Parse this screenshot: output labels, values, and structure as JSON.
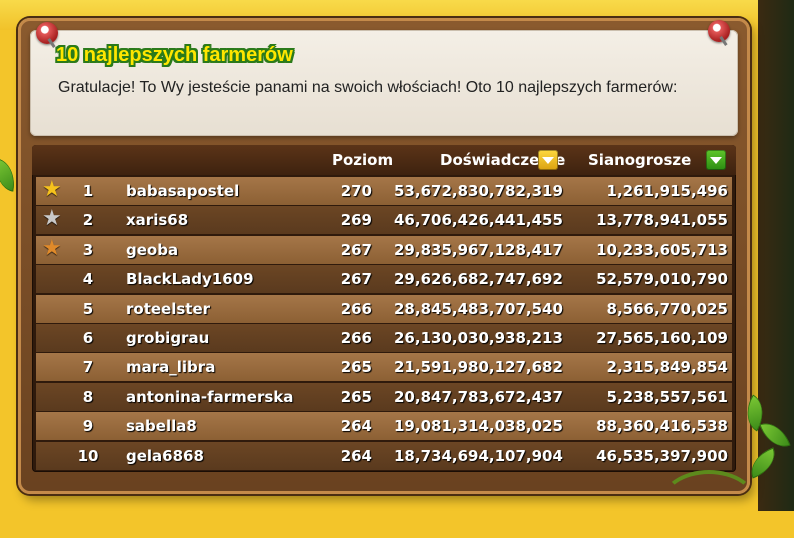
{
  "panel": {
    "title": "10 najlepszych farmerów",
    "subtitle": "Gratulacje! To Wy jesteście panami na swoich włościach! Oto 10 najlepszych farmerów:"
  },
  "table": {
    "headers": {
      "level": "Poziom",
      "experience": "Doświadczenie",
      "coins": "Sianogrosze"
    },
    "sort_buttons": [
      {
        "column": "experience",
        "icon": "chevron-down-icon",
        "color": "#f2b81c"
      },
      {
        "column": "coins",
        "icon": "chevron-down-icon",
        "color": "#3ea81d"
      }
    ],
    "rows": [
      {
        "rank": "1",
        "name": "babasapostel",
        "level": "270",
        "xp": "53,672,830,782,319",
        "coins": "1,261,915,496",
        "medal": "gold-star-icon",
        "medal_color": "#f6c21c"
      },
      {
        "rank": "2",
        "name": "xaris68",
        "level": "269",
        "xp": "46,706,426,441,455",
        "coins": "13,778,941,055",
        "medal": "silver-star-icon",
        "medal_color": "#c9c9c9"
      },
      {
        "rank": "3",
        "name": "geoba",
        "level": "267",
        "xp": "29,835,967,128,417",
        "coins": "10,233,605,713",
        "medal": "bronze-star-icon",
        "medal_color": "#e08a2a"
      },
      {
        "rank": "4",
        "name": "BlackLady1609",
        "level": "267",
        "xp": "29,626,682,747,692",
        "coins": "52,579,010,790"
      },
      {
        "rank": "5",
        "name": "roteelster",
        "level": "266",
        "xp": "28,845,483,707,540",
        "coins": "8,566,770,025"
      },
      {
        "rank": "6",
        "name": "grobigrau",
        "level": "266",
        "xp": "26,130,030,938,213",
        "coins": "27,565,160,109"
      },
      {
        "rank": "7",
        "name": "mara_libra",
        "level": "265",
        "xp": "21,591,980,127,682",
        "coins": "2,315,849,854"
      },
      {
        "rank": "8",
        "name": "antonina-farmerska",
        "level": "265",
        "xp": "20,847,783,672,437",
        "coins": "5,238,557,561"
      },
      {
        "rank": "9",
        "name": "sabella8",
        "level": "264",
        "xp": "19,081,314,038,025",
        "coins": "88,360,416,538"
      },
      {
        "rank": "10",
        "name": "gela6868",
        "level": "264",
        "xp": "18,734,694,107,904",
        "coins": "46,535,397,900"
      }
    ]
  }
}
